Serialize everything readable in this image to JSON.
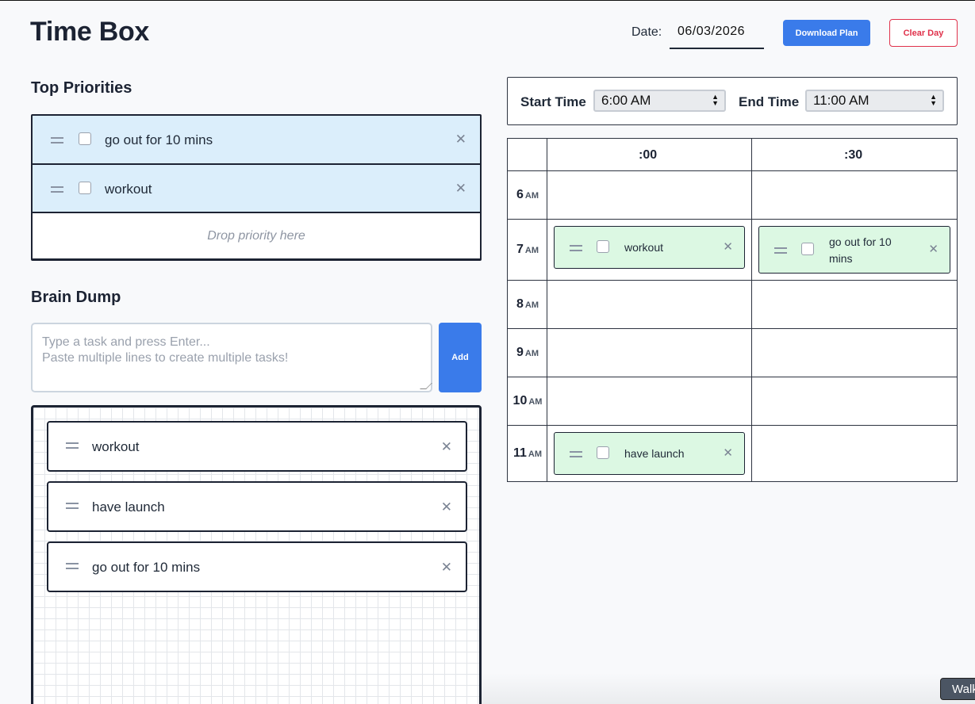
{
  "header": {
    "title": "Time Box",
    "date_label": "Date:",
    "date_value": "06/03/2026",
    "download_label": "Download Plan",
    "clear_label": "Clear Day"
  },
  "priorities": {
    "title": "Top Priorities",
    "items": [
      {
        "label": "go out for 10 mins",
        "checked": false
      },
      {
        "label": "workout",
        "checked": false
      }
    ],
    "drop_text": "Drop priority here"
  },
  "brain_dump": {
    "title": "Brain Dump",
    "placeholder_line1": "Type a task and press Enter...",
    "placeholder_line2": "Paste multiple lines to create multiple tasks!",
    "add_label": "Add",
    "items": [
      {
        "label": "workout"
      },
      {
        "label": "have launch"
      },
      {
        "label": "go out for 10 mins"
      }
    ]
  },
  "time_range": {
    "start_label": "Start Time",
    "start_value": "6:00 AM",
    "end_label": "End Time",
    "end_value": "11:00 AM"
  },
  "schedule": {
    "col_00": ":00",
    "col_30": ":30",
    "hours": [
      {
        "hour": "6",
        "ampm": "AM"
      },
      {
        "hour": "7",
        "ampm": "AM"
      },
      {
        "hour": "8",
        "ampm": "AM"
      },
      {
        "hour": "9",
        "ampm": "AM"
      },
      {
        "hour": "10",
        "ampm": "AM"
      },
      {
        "hour": "11",
        "ampm": "AM"
      }
    ],
    "items": {
      "h7_00": {
        "label": "workout",
        "checked": false
      },
      "h7_30": {
        "label": "go out for 10 mins",
        "checked": false
      },
      "h11_00": {
        "label": "have launch",
        "checked": false
      }
    }
  },
  "walkthrough_label": "Walk",
  "colors": {
    "accent": "#3a7bea",
    "danger": "#e0314b",
    "priority_bg": "#dbeefb",
    "scheduled_bg": "#dcf8e3"
  }
}
